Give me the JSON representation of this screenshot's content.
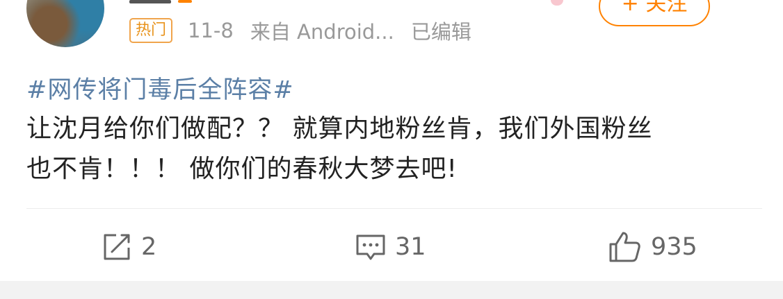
{
  "post": {
    "follow_label": "+ 关注",
    "hot_badge": "热门",
    "date": "11-8",
    "source": "来自 Android...",
    "edited": "已编辑",
    "topic": "#网传将门毒后全阵容#",
    "content_line1": "让沈月给你们做配？？ 就算内地粉丝肯，我们外国粉丝",
    "content_line2": "也不肯！！！ 做你们的春秋大梦去吧!"
  },
  "actions": {
    "repost_count": "2",
    "comment_count": "31",
    "like_count": "935"
  },
  "colors": {
    "accent": "#ff8200",
    "topic_link": "#5b7fa6",
    "meta_text": "#999999"
  },
  "icons": [
    "repost-icon",
    "comment-icon",
    "like-icon"
  ]
}
